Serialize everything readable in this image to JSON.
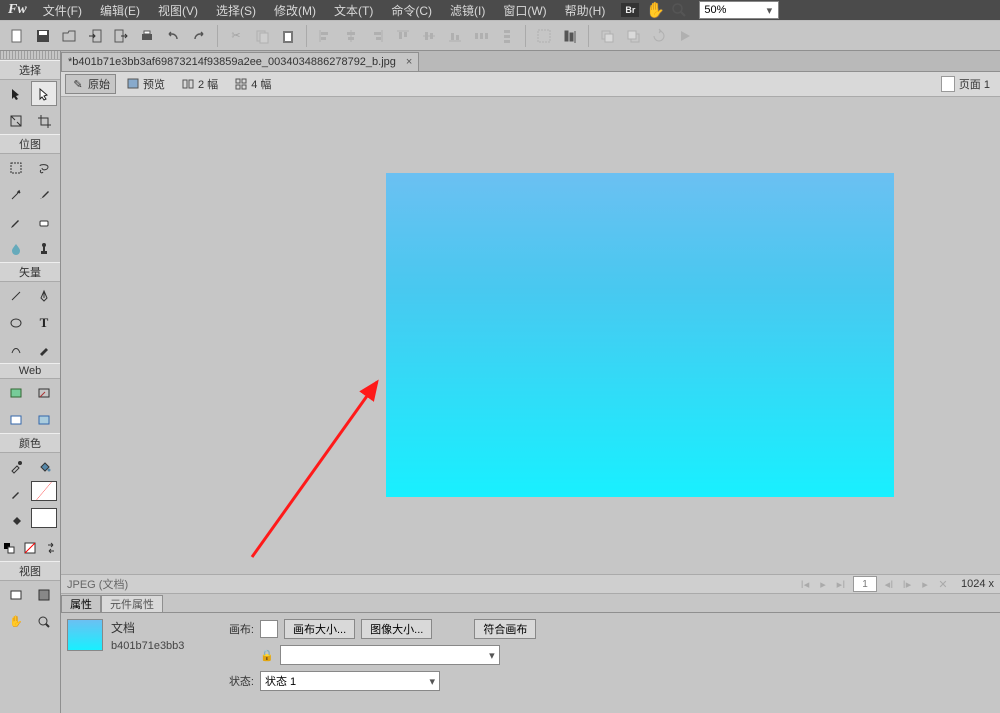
{
  "menus": [
    "文件(F)",
    "编辑(E)",
    "视图(V)",
    "选择(S)",
    "修改(M)",
    "文本(T)",
    "命令(C)",
    "滤镜(I)",
    "窗口(W)",
    "帮助(H)"
  ],
  "zoom": "50%",
  "document": {
    "tab_title": "*b401b71e3bb3af69873214f93859a2ee_0034034886278792_b.jpg",
    "tab_close": "×"
  },
  "viewmodes": {
    "original": "原始",
    "preview": "预览",
    "two_up": "2 幅",
    "four_up": "4 幅"
  },
  "page_label": "页面 1",
  "tool_sections": {
    "select": "选择",
    "bitmap": "位图",
    "vector": "矢量",
    "web": "Web",
    "colors": "颜色",
    "view": "视图"
  },
  "status": {
    "type": "JPEG (文档)",
    "page_num": "1",
    "dims": "1024 x"
  },
  "panel_tabs": {
    "props": "属性",
    "elem": "元件属性"
  },
  "panel": {
    "doc_label": "文档",
    "filename": "b401b71e3bb3",
    "canvas_label": "画布:",
    "btn_canvas_size": "画布大小...",
    "btn_image_size": "图像大小...",
    "btn_fit": "符合画布",
    "state_label": "状态:",
    "state_value": "状态 1"
  }
}
